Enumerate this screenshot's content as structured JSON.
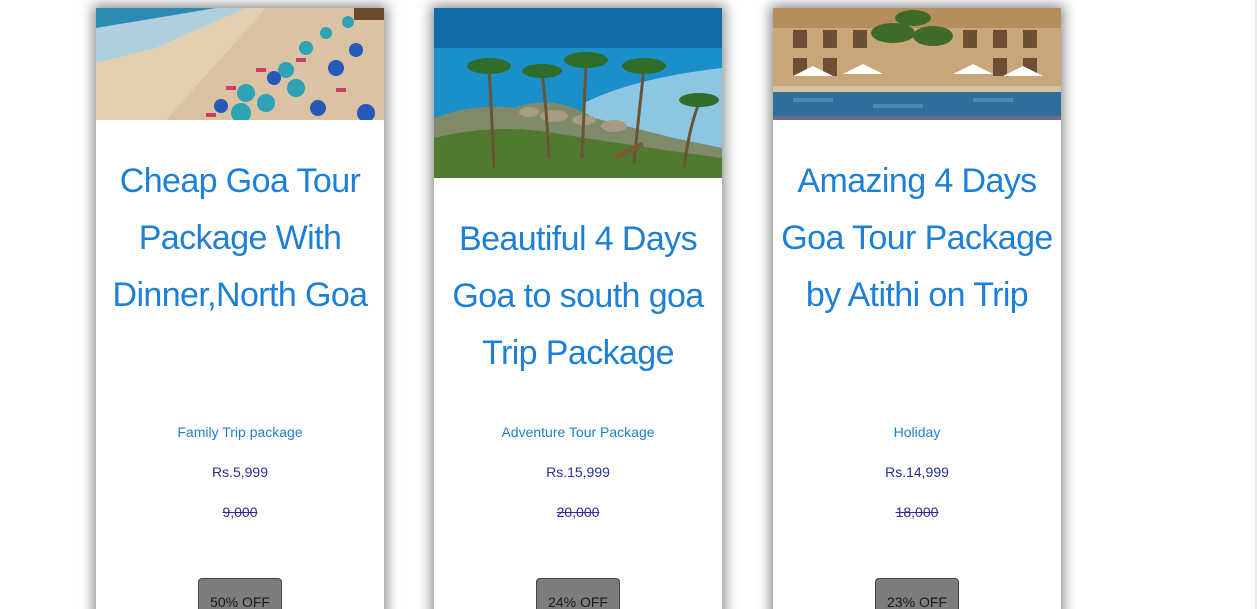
{
  "cards": [
    {
      "title": "Cheap Goa Tour Package With Dinner,North Goa",
      "category": "Family Trip package",
      "price": "Rs.5,999",
      "old_price": "9,000",
      "discount": "50% OFF",
      "image": "beach-umbrellas-photo"
    },
    {
      "title": "Beautiful 4 Days Goa to south goa Trip Package",
      "category": "Adventure Tour Package",
      "price": "Rs.15,999",
      "old_price": "20,000",
      "discount": "24% OFF",
      "image": "coastal-palm-cliff-photo"
    },
    {
      "title": "Amazing 4 Days Goa Tour Package by Atithi on Trip",
      "category": "Holiday",
      "price": "Rs.14,999",
      "old_price": "18,000",
      "discount": "23% OFF",
      "image": "resort-pool-photo"
    }
  ],
  "colors": {
    "title": "#1e7fd6",
    "category": "#1f7ed1",
    "price": "#2a2e96",
    "discount_bg": "#7d7d7d"
  }
}
